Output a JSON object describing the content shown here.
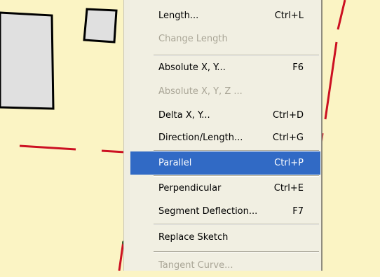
{
  "colors": {
    "background": "#fbf4c4",
    "selection": "#316ac5",
    "sketch_line": "#cc1022",
    "menu_bg": "#f1efe2",
    "disabled_text": "#a9a596"
  },
  "menu": {
    "items": [
      {
        "label": "Length...",
        "shortcut": "Ctrl+L",
        "disabled": false
      },
      {
        "label": "Change Length",
        "shortcut": "",
        "disabled": true
      },
      {
        "label": "Absolute X, Y...",
        "shortcut": "F6",
        "disabled": false
      },
      {
        "label": "Absolute X, Y, Z ...",
        "shortcut": "",
        "disabled": true
      },
      {
        "label": "Delta X, Y...",
        "shortcut": "Ctrl+D",
        "disabled": false
      },
      {
        "label": "Direction/Length...",
        "shortcut": "Ctrl+G",
        "disabled": false
      },
      {
        "label": "Parallel",
        "shortcut": "Ctrl+P",
        "disabled": false,
        "selected": true
      },
      {
        "label": "Perpendicular",
        "shortcut": "Ctrl+E",
        "disabled": false
      },
      {
        "label": "Segment Deflection...",
        "shortcut": "F7",
        "disabled": false
      },
      {
        "label": "Replace Sketch",
        "shortcut": "",
        "disabled": false
      },
      {
        "label": "Tangent Curve...",
        "shortcut": "",
        "disabled": true
      }
    ]
  }
}
